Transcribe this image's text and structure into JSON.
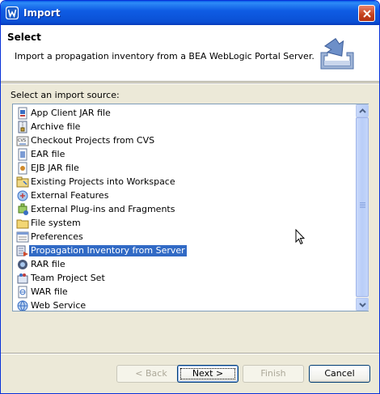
{
  "window": {
    "title": "Import"
  },
  "header": {
    "title": "Select",
    "description": "Import a propagation inventory from a BEA WebLogic Portal Server."
  },
  "list": {
    "label": "Select an import source:",
    "items": [
      {
        "label": "App Client JAR file",
        "icon": "app-client-jar-icon"
      },
      {
        "label": "Archive file",
        "icon": "archive-file-icon"
      },
      {
        "label": "Checkout Projects from CVS",
        "icon": "cvs-checkout-icon"
      },
      {
        "label": "EAR file",
        "icon": "ear-file-icon"
      },
      {
        "label": "EJB JAR file",
        "icon": "ejb-jar-icon"
      },
      {
        "label": "Existing Projects into Workspace",
        "icon": "existing-projects-icon"
      },
      {
        "label": "External Features",
        "icon": "external-features-icon"
      },
      {
        "label": "External Plug-ins and Fragments",
        "icon": "plugin-icon"
      },
      {
        "label": "File system",
        "icon": "folder-icon"
      },
      {
        "label": "Preferences",
        "icon": "preferences-icon"
      },
      {
        "label": "Propagation Inventory from Server",
        "icon": "propagation-inventory-icon",
        "selected": true
      },
      {
        "label": "RAR file",
        "icon": "rar-file-icon"
      },
      {
        "label": "Team Project Set",
        "icon": "team-project-set-icon"
      },
      {
        "label": "WAR file",
        "icon": "war-file-icon"
      },
      {
        "label": "Web Service",
        "icon": "web-service-icon"
      }
    ]
  },
  "buttons": {
    "back": "< Back",
    "next": "Next >",
    "finish": "Finish",
    "cancel": "Cancel"
  },
  "colors": {
    "titlebar": "#0a4fd4",
    "selection": "#316ac5",
    "dialog_bg": "#ece9d8"
  }
}
